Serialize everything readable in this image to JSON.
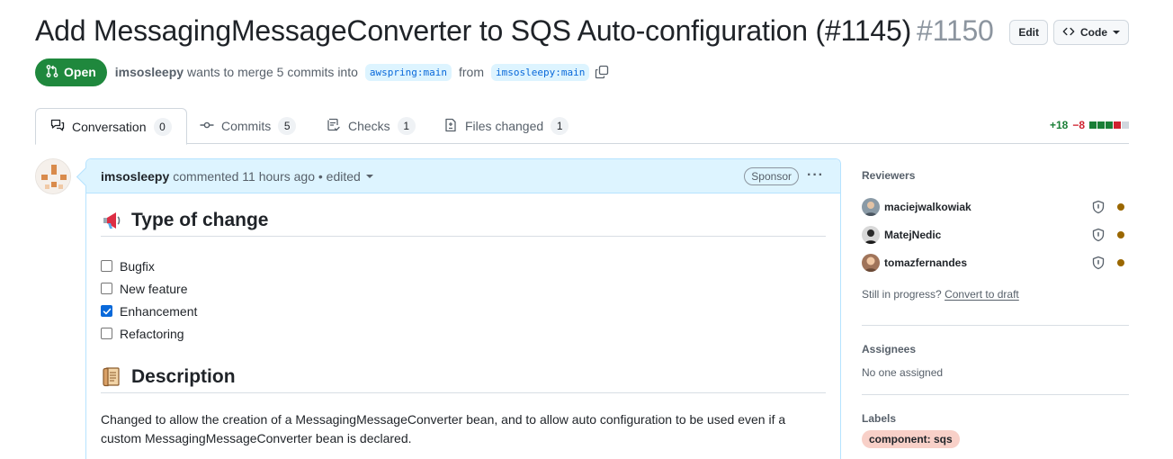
{
  "header": {
    "title": "Add MessagingMessageConverter to SQS Auto-configuration (#1145)",
    "number": "#1150",
    "edit_label": "Edit",
    "code_label": "Code"
  },
  "meta": {
    "state": "Open",
    "author": "imsosleepy",
    "action_text": "wants to merge 5 commits into",
    "base_branch": "awspring:main",
    "from_text": "from",
    "head_branch": "imsosleepy:main"
  },
  "tabs": [
    {
      "label": "Conversation",
      "count": "0",
      "icon": "comment-discussion-icon"
    },
    {
      "label": "Commits",
      "count": "5",
      "icon": "git-commit-icon"
    },
    {
      "label": "Checks",
      "count": "1",
      "icon": "checklist-icon"
    },
    {
      "label": "Files changed",
      "count": "1",
      "icon": "file-diff-icon"
    }
  ],
  "diffstat": {
    "additions": "+18",
    "deletions": "−8",
    "colors": {
      "add": "#1a7f37",
      "del": "#cf222e",
      "neutral": "#d0d7de"
    }
  },
  "comment": {
    "author": "imsosleepy",
    "meta": "commented 11 hours ago • edited",
    "sponsor_label": "Sponsor",
    "section1_heading": "Type of change",
    "section1_emoji": "loudspeaker-icon",
    "checklist": [
      {
        "label": "Bugfix",
        "checked": false
      },
      {
        "label": "New feature",
        "checked": false
      },
      {
        "label": "Enhancement",
        "checked": true
      },
      {
        "label": "Refactoring",
        "checked": false
      }
    ],
    "section2_heading": "Description",
    "section2_emoji": "scroll-icon",
    "description": "Changed to allow the creation of a MessagingMessageConverter bean, and to allow auto configuration to be used even if a custom MessagingMessageConverter bean is declared."
  },
  "sidebar": {
    "reviewers_heading": "Reviewers",
    "reviewers": [
      {
        "name": "maciejwalkowiak"
      },
      {
        "name": "MatejNedic"
      },
      {
        "name": "tomazfernandes"
      }
    ],
    "progress_text": "Still in progress?",
    "convert_link": "Convert to draft",
    "assignees_heading": "Assignees",
    "assignees_text": "No one assigned",
    "labels_heading": "Labels",
    "labels": [
      {
        "name": "component: sqs",
        "color": "#f8d0c8"
      }
    ],
    "pending_color": "#9a6700"
  },
  "colors": {
    "open_green": "#1f883d",
    "link_blue": "#0969da",
    "comment_header_bg": "#ddf4ff"
  }
}
